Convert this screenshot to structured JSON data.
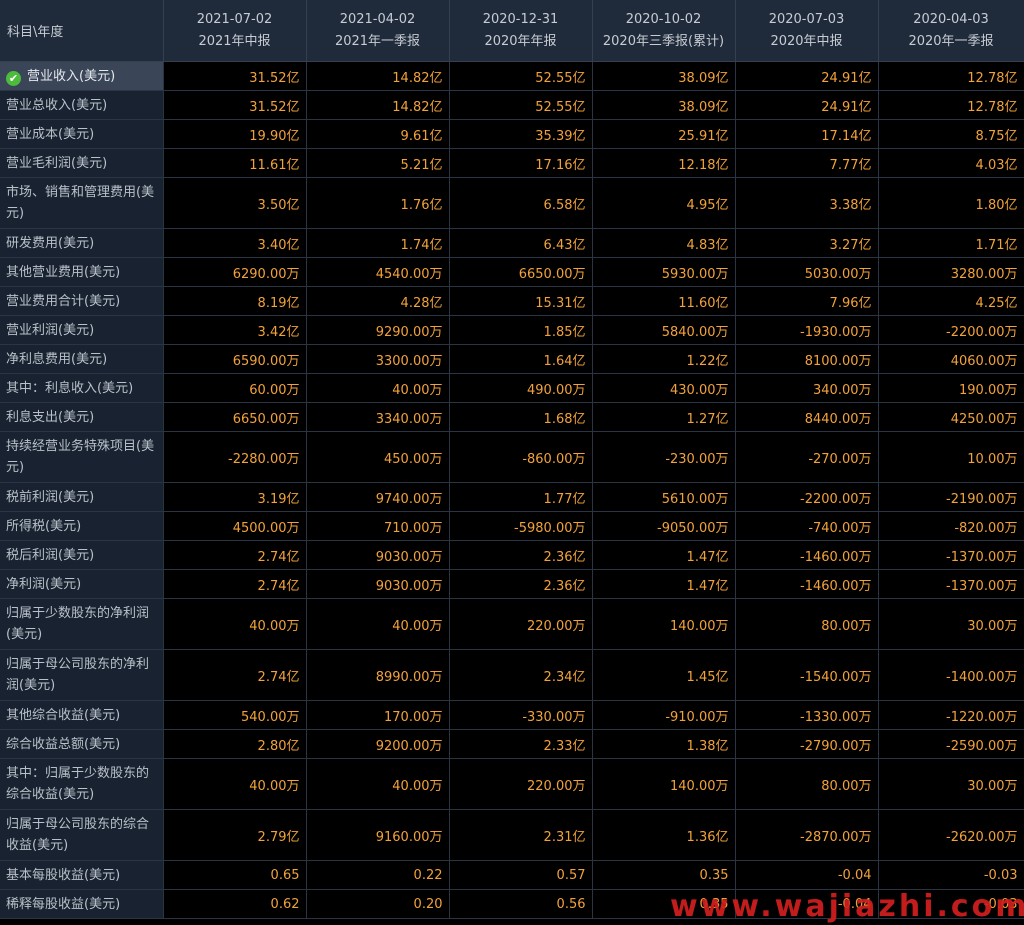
{
  "table": {
    "corner_label": "科目\\年度",
    "columns": [
      {
        "date": "2021-07-02",
        "period": "2021年中报"
      },
      {
        "date": "2021-04-02",
        "period": "2021年一季报"
      },
      {
        "date": "2020-12-31",
        "period": "2020年年报"
      },
      {
        "date": "2020-10-02",
        "period": "2020年三季报(累计)"
      },
      {
        "date": "2020-07-03",
        "period": "2020年中报"
      },
      {
        "date": "2020-04-03",
        "period": "2020年一季报"
      }
    ],
    "rows": [
      {
        "label": "营业收入(美元)",
        "values": [
          "31.52亿",
          "14.82亿",
          "52.55亿",
          "38.09亿",
          "24.91亿",
          "12.78亿"
        ],
        "selected": true
      },
      {
        "label": "营业总收入(美元)",
        "values": [
          "31.52亿",
          "14.82亿",
          "52.55亿",
          "38.09亿",
          "24.91亿",
          "12.78亿"
        ]
      },
      {
        "label": "营业成本(美元)",
        "values": [
          "19.90亿",
          "9.61亿",
          "35.39亿",
          "25.91亿",
          "17.14亿",
          "8.75亿"
        ]
      },
      {
        "label": "营业毛利润(美元)",
        "values": [
          "11.61亿",
          "5.21亿",
          "17.16亿",
          "12.18亿",
          "7.77亿",
          "4.03亿"
        ]
      },
      {
        "label": "市场、销售和管理费用(美元)",
        "values": [
          "3.50亿",
          "1.76亿",
          "6.58亿",
          "4.95亿",
          "3.38亿",
          "1.80亿"
        ],
        "tall": true
      },
      {
        "label": "研发费用(美元)",
        "values": [
          "3.40亿",
          "1.74亿",
          "6.43亿",
          "4.83亿",
          "3.27亿",
          "1.71亿"
        ]
      },
      {
        "label": "其他营业费用(美元)",
        "values": [
          "6290.00万",
          "4540.00万",
          "6650.00万",
          "5930.00万",
          "5030.00万",
          "3280.00万"
        ]
      },
      {
        "label": "营业费用合计(美元)",
        "values": [
          "8.19亿",
          "4.28亿",
          "15.31亿",
          "11.60亿",
          "7.96亿",
          "4.25亿"
        ]
      },
      {
        "label": "营业利润(美元)",
        "values": [
          "3.42亿",
          "9290.00万",
          "1.85亿",
          "5840.00万",
          "-1930.00万",
          "-2200.00万"
        ]
      },
      {
        "label": "净利息费用(美元)",
        "values": [
          "6590.00万",
          "3300.00万",
          "1.64亿",
          "1.22亿",
          "8100.00万",
          "4060.00万"
        ]
      },
      {
        "label": "其中：利息收入(美元)",
        "values": [
          "60.00万",
          "40.00万",
          "490.00万",
          "430.00万",
          "340.00万",
          "190.00万"
        ]
      },
      {
        "label": "利息支出(美元)",
        "values": [
          "6650.00万",
          "3340.00万",
          "1.68亿",
          "1.27亿",
          "8440.00万",
          "4250.00万"
        ]
      },
      {
        "label": "持续经营业务特殊项目(美元)",
        "values": [
          "-2280.00万",
          "450.00万",
          "-860.00万",
          "-230.00万",
          "-270.00万",
          "10.00万"
        ],
        "tall": true
      },
      {
        "label": "税前利润(美元)",
        "values": [
          "3.19亿",
          "9740.00万",
          "1.77亿",
          "5610.00万",
          "-2200.00万",
          "-2190.00万"
        ]
      },
      {
        "label": "所得税(美元)",
        "values": [
          "4500.00万",
          "710.00万",
          "-5980.00万",
          "-9050.00万",
          "-740.00万",
          "-820.00万"
        ]
      },
      {
        "label": "税后利润(美元)",
        "values": [
          "2.74亿",
          "9030.00万",
          "2.36亿",
          "1.47亿",
          "-1460.00万",
          "-1370.00万"
        ]
      },
      {
        "label": "净利润(美元)",
        "values": [
          "2.74亿",
          "9030.00万",
          "2.36亿",
          "1.47亿",
          "-1460.00万",
          "-1370.00万"
        ]
      },
      {
        "label": "归属于少数股东的净利润(美元)",
        "values": [
          "40.00万",
          "40.00万",
          "220.00万",
          "140.00万",
          "80.00万",
          "30.00万"
        ],
        "tall": true
      },
      {
        "label": "归属于母公司股东的净利润(美元)",
        "values": [
          "2.74亿",
          "8990.00万",
          "2.34亿",
          "1.45亿",
          "-1540.00万",
          "-1400.00万"
        ],
        "tall": true
      },
      {
        "label": "其他综合收益(美元)",
        "values": [
          "540.00万",
          "170.00万",
          "-330.00万",
          "-910.00万",
          "-1330.00万",
          "-1220.00万"
        ]
      },
      {
        "label": "综合收益总额(美元)",
        "values": [
          "2.80亿",
          "9200.00万",
          "2.33亿",
          "1.38亿",
          "-2790.00万",
          "-2590.00万"
        ]
      },
      {
        "label": "其中：归属于少数股东的综合收益(美元)",
        "values": [
          "40.00万",
          "40.00万",
          "220.00万",
          "140.00万",
          "80.00万",
          "30.00万"
        ],
        "tall": true
      },
      {
        "label": "归属于母公司股东的综合收益(美元)",
        "values": [
          "2.79亿",
          "9160.00万",
          "2.31亿",
          "1.36亿",
          "-2870.00万",
          "-2620.00万"
        ],
        "tall": true
      },
      {
        "label": "基本每股收益(美元)",
        "values": [
          "0.65",
          "0.22",
          "0.57",
          "0.35",
          "-0.04",
          "-0.03"
        ]
      },
      {
        "label": "稀释每股收益(美元)",
        "values": [
          "0.62",
          "0.20",
          "0.56",
          "0.35",
          "-0.04",
          "-0.03"
        ]
      }
    ]
  },
  "selected_icon": "check-circle-icon",
  "watermark": "www.wajiazhi.com",
  "colors": {
    "value_text": "#f2a23a",
    "label_bg": "#182230",
    "header_bg": "#1f2a3a",
    "selected_bg": "#3a4658",
    "check_green": "#4dbb3c",
    "watermark_red": "#d21e1e"
  }
}
